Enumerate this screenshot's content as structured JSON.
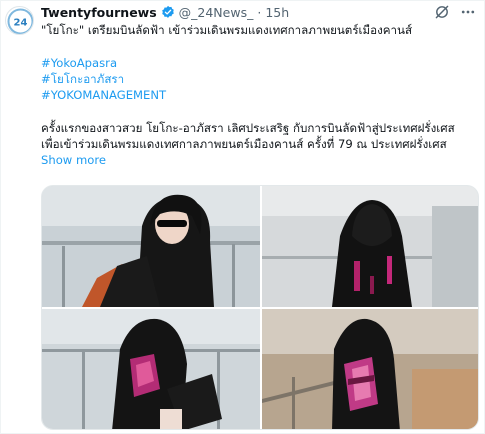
{
  "account": {
    "display_name": "Twentyfournews",
    "handle": "@_24News_",
    "separator": "·",
    "time": "15h",
    "avatar_text": "24",
    "verified_icon": "verified-badge-icon",
    "brand_color": "#1d9bf0"
  },
  "post": {
    "headline": "\"โยโกะ\" เตรียมบินลัดฟ้า เข้าร่วมเดินพรมแดงเทศกาลภาพยนตร์เมืองคานส์",
    "hashtags": [
      "#YokoApasra",
      "#โยโกะอาภัสรา",
      "#YOKOMANAGEMENT"
    ],
    "body_line1": "ครั้งแรกของสาวสวย โยโกะ-อาภัสรา เลิศประเสริฐ กับการบินลัดฟ้าสู่ประเทศฝรั่งเศส",
    "body_line2": "เพื่อเข้าร่วมเดินพรมแดงเทศกาลภาพยนตร์เมืองคานส์ ครั้งที่ 79 ณ ประเทศฝรั่งเศส",
    "show_more": "Show more"
  },
  "icons": {
    "grok": "grok-icon",
    "more": "more-options-icon"
  },
  "media": {
    "count": 4,
    "photos": [
      "photo-1",
      "photo-2",
      "photo-3",
      "photo-4"
    ]
  }
}
